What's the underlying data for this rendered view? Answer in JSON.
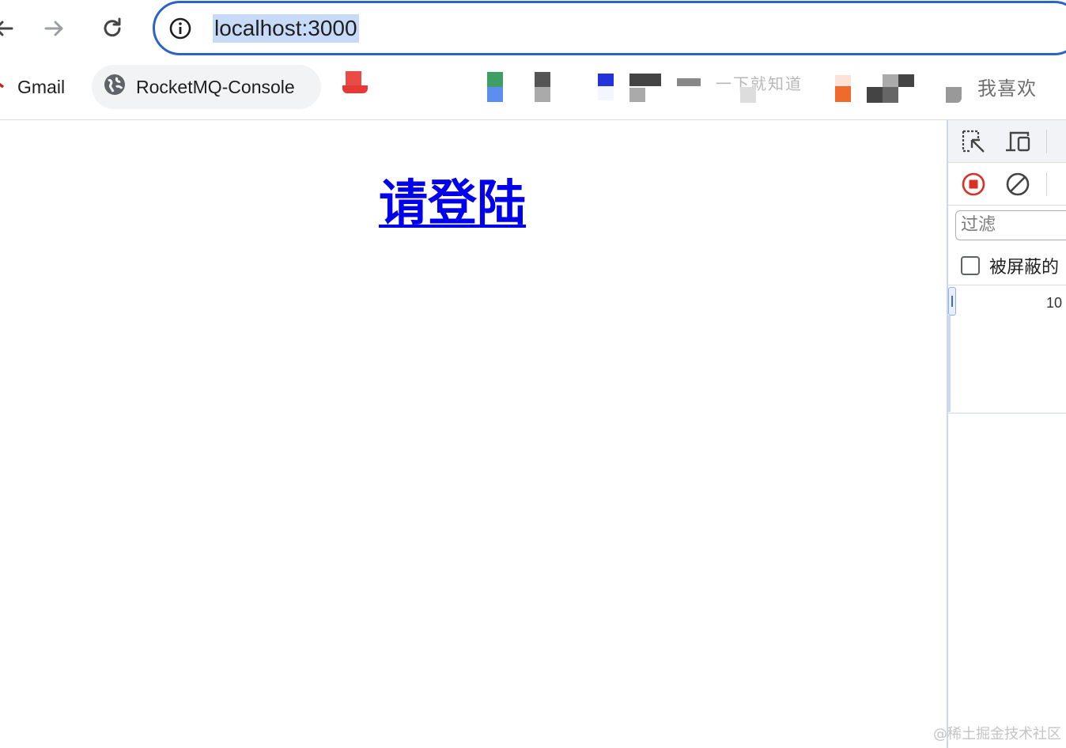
{
  "browser": {
    "url": "localhost:3000",
    "bookmarks": [
      {
        "label": "Gmail"
      },
      {
        "label": "RocketMQ-Console"
      },
      {
        "label": "一下就知道"
      },
      {
        "label": "我喜欢"
      }
    ]
  },
  "page": {
    "login_link": "请登陆"
  },
  "devtools": {
    "filter_placeholder": "过滤",
    "blocked_label": "被屏蔽的",
    "timeline_tick": "10"
  },
  "watermark": "@稀土掘金技术社区",
  "colors": {
    "omnibox_border": "#2b63c9",
    "url_highlight": "#c7dbf8",
    "link": "#0000ee",
    "record_red": "#d93025"
  }
}
